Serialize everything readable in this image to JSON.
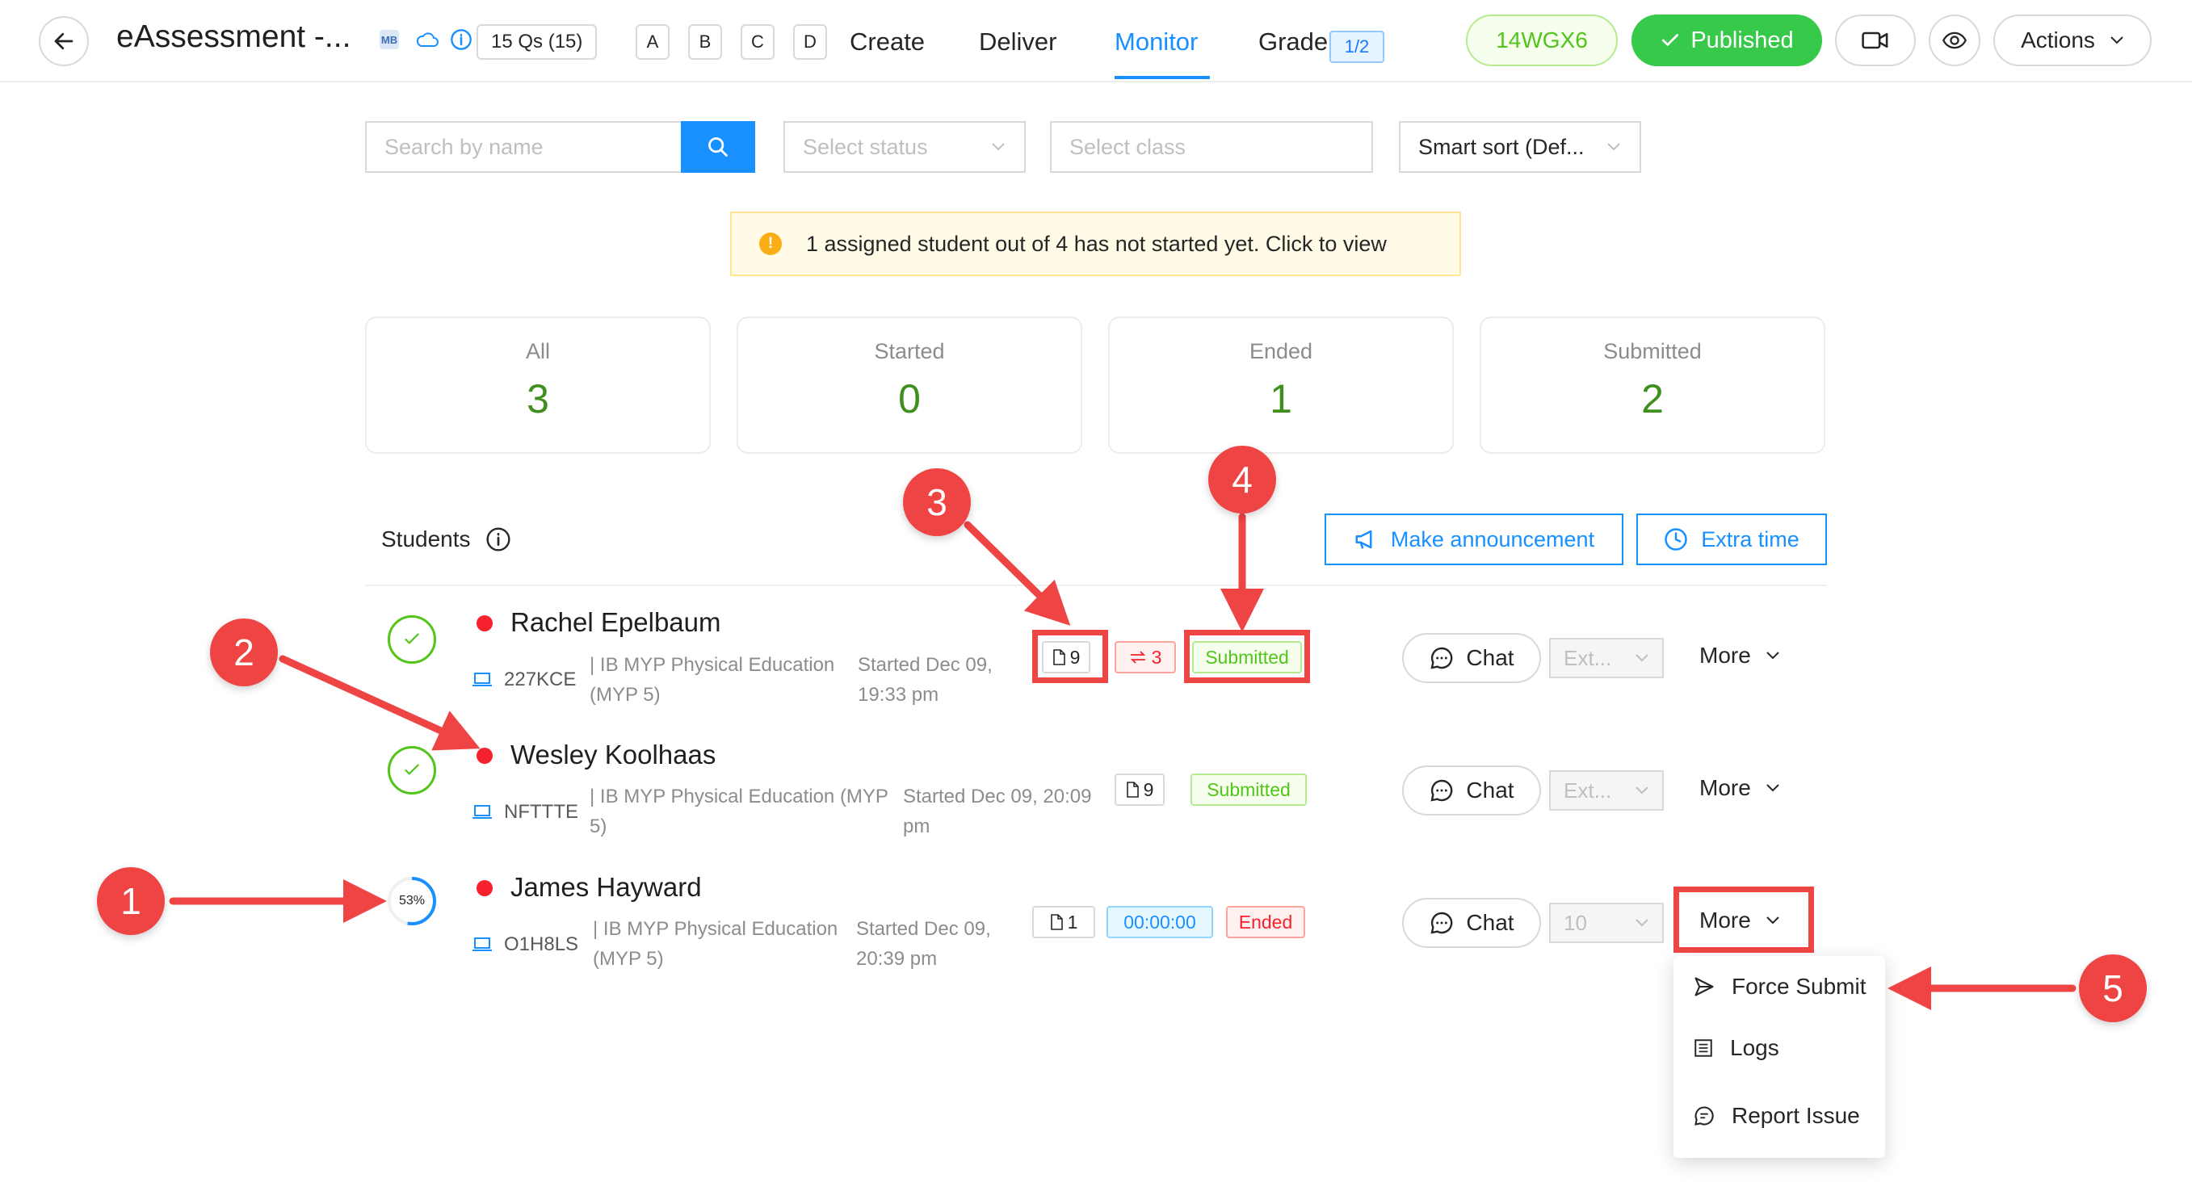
{
  "header": {
    "title": "eAssessment -...",
    "mb_badge": "MB",
    "questions_badge": "15 Qs (15)",
    "options": [
      "A",
      "B",
      "C",
      "D"
    ],
    "tabs": [
      {
        "label": "Create"
      },
      {
        "label": "Deliver"
      },
      {
        "label": "Monitor",
        "active": true
      },
      {
        "label": "Grade"
      }
    ],
    "grade_badge": "1/2",
    "code": "14WGX6",
    "status": "Published",
    "actions_label": "Actions",
    "icons": [
      "back-arrow-icon",
      "cloud-icon",
      "info-icon",
      "video-icon",
      "eye-icon",
      "chevron-down-icon"
    ]
  },
  "filters": {
    "search_placeholder": "Search by name",
    "status_placeholder": "Select status",
    "class_placeholder": "Select class",
    "sort_value": "Smart sort (Def..."
  },
  "alert": {
    "text": "1 assigned student out of 4 has not started yet. Click to view"
  },
  "stats": [
    {
      "label": "All",
      "value": "3"
    },
    {
      "label": "Started",
      "value": "0"
    },
    {
      "label": "Ended",
      "value": "1"
    },
    {
      "label": "Submitted",
      "value": "2"
    }
  ],
  "students_toolbar": {
    "label": "Students",
    "announce_label": "Make announcement",
    "extra_time_label": "Extra time"
  },
  "students": [
    {
      "name": "Rachel Epelbaum",
      "code": "227KCE",
      "class_line1": "| IB MYP Physical Education",
      "class_line2": "(MYP 5)",
      "started_line1": "Started Dec 09,",
      "started_line2": "19:33 pm",
      "pages": "9",
      "switches": "3",
      "status": "Submitted",
      "chat_label": "Chat",
      "ext_value": "Ext...",
      "more_label": "More"
    },
    {
      "name": "Wesley Koolhaas",
      "code": "NFTTTE",
      "class_line1": "| IB MYP Physical Education (MYP",
      "class_line2": "5)",
      "started_line1": "Started Dec 09, 20:09",
      "started_line2": "pm",
      "pages": "9",
      "status": "Submitted",
      "chat_label": "Chat",
      "ext_value": "Ext...",
      "more_label": "More"
    },
    {
      "name": "James Hayward",
      "code": "O1H8LS",
      "class_line1": "| IB MYP Physical Education",
      "class_line2": "(MYP 5)",
      "started_line1": "Started Dec 09,",
      "started_line2": "20:39 pm",
      "pages": "1",
      "timer": "00:00:00",
      "status": "Ended",
      "progress": "53%",
      "progress_fraction": 0.53,
      "chat_label": "Chat",
      "ext_value": "10",
      "more_label": "More"
    }
  ],
  "more_menu": {
    "items": [
      {
        "label": "Force Submit",
        "icon": "send-icon"
      },
      {
        "label": "Logs",
        "icon": "list-icon"
      },
      {
        "label": "Report Issue",
        "icon": "comment-icon"
      }
    ]
  },
  "annotations": [
    {
      "number": "1"
    },
    {
      "number": "2"
    },
    {
      "number": "3"
    },
    {
      "number": "4"
    },
    {
      "number": "5"
    }
  ],
  "colors": {
    "primary": "#1890ff",
    "published": "#37c94a",
    "success": "#52c41a",
    "danger": "#f5222d",
    "annotation": "#ef4444",
    "stat_value": "#3f8f1f"
  }
}
